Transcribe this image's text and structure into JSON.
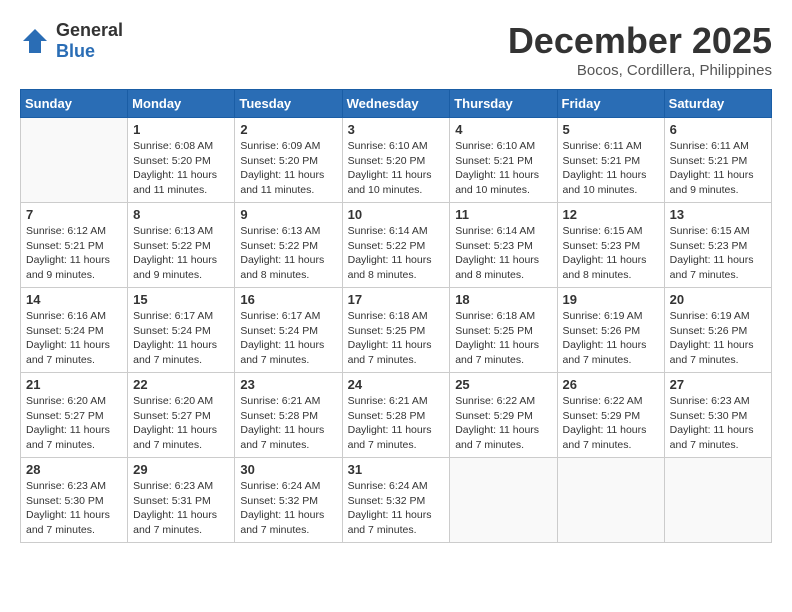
{
  "header": {
    "logo_general": "General",
    "logo_blue": "Blue",
    "month_title": "December 2025",
    "location": "Bocos, Cordillera, Philippines"
  },
  "days_of_week": [
    "Sunday",
    "Monday",
    "Tuesday",
    "Wednesday",
    "Thursday",
    "Friday",
    "Saturday"
  ],
  "weeks": [
    [
      {
        "day": "",
        "info": ""
      },
      {
        "day": "1",
        "info": "Sunrise: 6:08 AM\nSunset: 5:20 PM\nDaylight: 11 hours and 11 minutes."
      },
      {
        "day": "2",
        "info": "Sunrise: 6:09 AM\nSunset: 5:20 PM\nDaylight: 11 hours and 11 minutes."
      },
      {
        "day": "3",
        "info": "Sunrise: 6:10 AM\nSunset: 5:20 PM\nDaylight: 11 hours and 10 minutes."
      },
      {
        "day": "4",
        "info": "Sunrise: 6:10 AM\nSunset: 5:21 PM\nDaylight: 11 hours and 10 minutes."
      },
      {
        "day": "5",
        "info": "Sunrise: 6:11 AM\nSunset: 5:21 PM\nDaylight: 11 hours and 10 minutes."
      },
      {
        "day": "6",
        "info": "Sunrise: 6:11 AM\nSunset: 5:21 PM\nDaylight: 11 hours and 9 minutes."
      }
    ],
    [
      {
        "day": "7",
        "info": "Sunrise: 6:12 AM\nSunset: 5:21 PM\nDaylight: 11 hours and 9 minutes."
      },
      {
        "day": "8",
        "info": "Sunrise: 6:13 AM\nSunset: 5:22 PM\nDaylight: 11 hours and 9 minutes."
      },
      {
        "day": "9",
        "info": "Sunrise: 6:13 AM\nSunset: 5:22 PM\nDaylight: 11 hours and 8 minutes."
      },
      {
        "day": "10",
        "info": "Sunrise: 6:14 AM\nSunset: 5:22 PM\nDaylight: 11 hours and 8 minutes."
      },
      {
        "day": "11",
        "info": "Sunrise: 6:14 AM\nSunset: 5:23 PM\nDaylight: 11 hours and 8 minutes."
      },
      {
        "day": "12",
        "info": "Sunrise: 6:15 AM\nSunset: 5:23 PM\nDaylight: 11 hours and 8 minutes."
      },
      {
        "day": "13",
        "info": "Sunrise: 6:15 AM\nSunset: 5:23 PM\nDaylight: 11 hours and 7 minutes."
      }
    ],
    [
      {
        "day": "14",
        "info": "Sunrise: 6:16 AM\nSunset: 5:24 PM\nDaylight: 11 hours and 7 minutes."
      },
      {
        "day": "15",
        "info": "Sunrise: 6:17 AM\nSunset: 5:24 PM\nDaylight: 11 hours and 7 minutes."
      },
      {
        "day": "16",
        "info": "Sunrise: 6:17 AM\nSunset: 5:24 PM\nDaylight: 11 hours and 7 minutes."
      },
      {
        "day": "17",
        "info": "Sunrise: 6:18 AM\nSunset: 5:25 PM\nDaylight: 11 hours and 7 minutes."
      },
      {
        "day": "18",
        "info": "Sunrise: 6:18 AM\nSunset: 5:25 PM\nDaylight: 11 hours and 7 minutes."
      },
      {
        "day": "19",
        "info": "Sunrise: 6:19 AM\nSunset: 5:26 PM\nDaylight: 11 hours and 7 minutes."
      },
      {
        "day": "20",
        "info": "Sunrise: 6:19 AM\nSunset: 5:26 PM\nDaylight: 11 hours and 7 minutes."
      }
    ],
    [
      {
        "day": "21",
        "info": "Sunrise: 6:20 AM\nSunset: 5:27 PM\nDaylight: 11 hours and 7 minutes."
      },
      {
        "day": "22",
        "info": "Sunrise: 6:20 AM\nSunset: 5:27 PM\nDaylight: 11 hours and 7 minutes."
      },
      {
        "day": "23",
        "info": "Sunrise: 6:21 AM\nSunset: 5:28 PM\nDaylight: 11 hours and 7 minutes."
      },
      {
        "day": "24",
        "info": "Sunrise: 6:21 AM\nSunset: 5:28 PM\nDaylight: 11 hours and 7 minutes."
      },
      {
        "day": "25",
        "info": "Sunrise: 6:22 AM\nSunset: 5:29 PM\nDaylight: 11 hours and 7 minutes."
      },
      {
        "day": "26",
        "info": "Sunrise: 6:22 AM\nSunset: 5:29 PM\nDaylight: 11 hours and 7 minutes."
      },
      {
        "day": "27",
        "info": "Sunrise: 6:23 AM\nSunset: 5:30 PM\nDaylight: 11 hours and 7 minutes."
      }
    ],
    [
      {
        "day": "28",
        "info": "Sunrise: 6:23 AM\nSunset: 5:30 PM\nDaylight: 11 hours and 7 minutes."
      },
      {
        "day": "29",
        "info": "Sunrise: 6:23 AM\nSunset: 5:31 PM\nDaylight: 11 hours and 7 minutes."
      },
      {
        "day": "30",
        "info": "Sunrise: 6:24 AM\nSunset: 5:32 PM\nDaylight: 11 hours and 7 minutes."
      },
      {
        "day": "31",
        "info": "Sunrise: 6:24 AM\nSunset: 5:32 PM\nDaylight: 11 hours and 7 minutes."
      },
      {
        "day": "",
        "info": ""
      },
      {
        "day": "",
        "info": ""
      },
      {
        "day": "",
        "info": ""
      }
    ]
  ]
}
